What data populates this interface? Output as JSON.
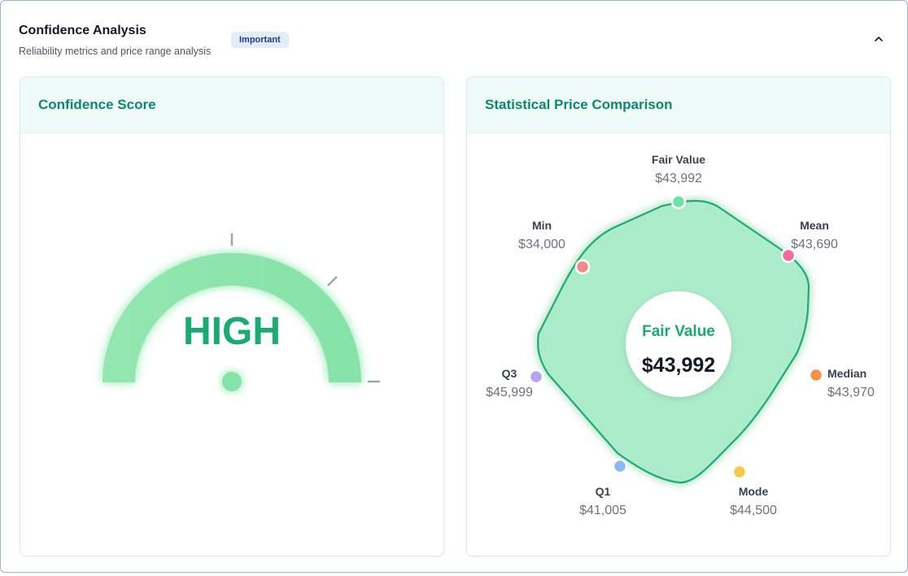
{
  "header": {
    "title": "Confidence Analysis",
    "subtitle": "Reliability metrics and price range analysis",
    "badge": "Important"
  },
  "icons": {
    "collapse": "chevron-up-icon"
  },
  "confidence_panel": {
    "title": "Confidence Score",
    "level": "HIGH",
    "gauge_color": "#86e3a8",
    "text_color": "#1aab72"
  },
  "comparison_panel": {
    "title": "Statistical Price Comparison",
    "center_label": "Fair Value",
    "center_value": "$43,992",
    "points": [
      {
        "key": "fair_value",
        "label": "Fair Value",
        "value_text": "$43,992",
        "value": 43992,
        "color": "#6ee2a4"
      },
      {
        "key": "mean",
        "label": "Mean",
        "value_text": "$43,690",
        "value": 43690,
        "color": "#ee6b9e"
      },
      {
        "key": "median",
        "label": "Median",
        "value_text": "$43,970",
        "value": 43970,
        "color": "#f4904a"
      },
      {
        "key": "mode",
        "label": "Mode",
        "value_text": "$44,500",
        "value": 44500,
        "color": "#f6c94a"
      },
      {
        "key": "q1",
        "label": "Q1",
        "value_text": "$41,005",
        "value": 41005,
        "color": "#8ab8f2"
      },
      {
        "key": "q3",
        "label": "Q3",
        "value_text": "$45,999",
        "value": 45999,
        "color": "#b6a4f2"
      },
      {
        "key": "min",
        "label": "Min",
        "value_text": "$34,000",
        "value": 34000,
        "color": "#f08a8a"
      }
    ],
    "colors": {
      "fill": "#a9ecc9",
      "stroke": "#1aab72",
      "title": "#0b8a6b"
    }
  }
}
